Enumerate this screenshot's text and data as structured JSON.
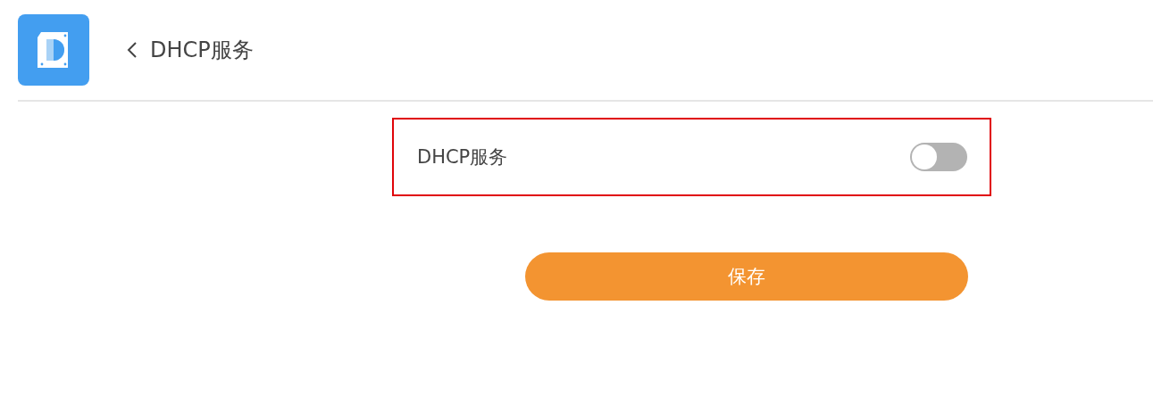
{
  "header": {
    "title": "DHCP服务"
  },
  "setting": {
    "label": "DHCP服务",
    "on": false
  },
  "buttons": [
    {
      "label": "保存"
    }
  ]
}
